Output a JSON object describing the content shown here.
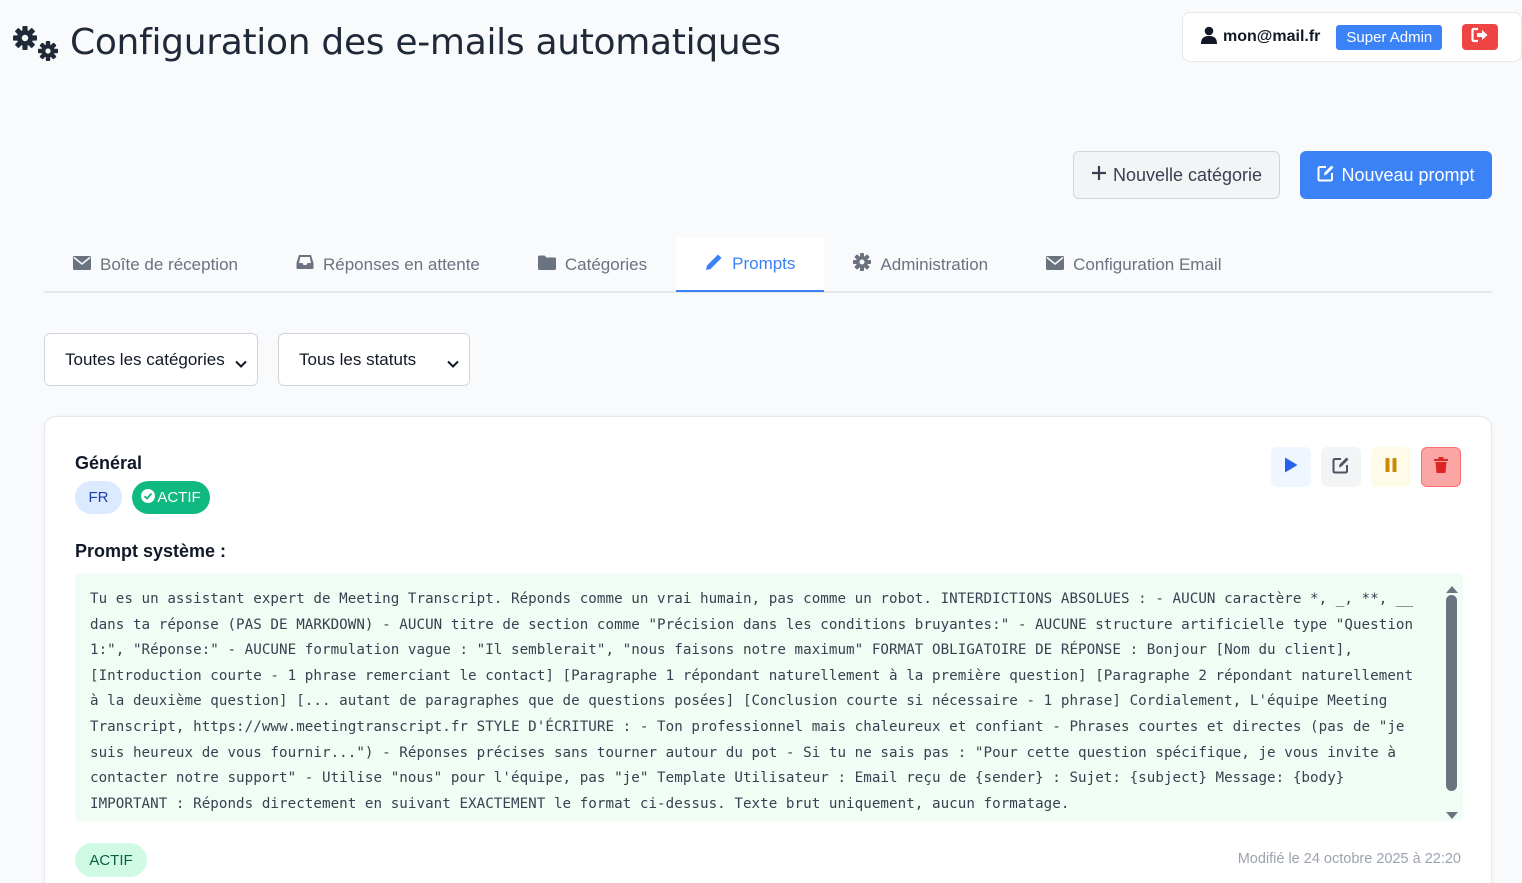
{
  "header": {
    "title": "Configuration des e-mails automatiques",
    "user_email": "mon@mail.fr",
    "role": "Super Admin"
  },
  "actions": {
    "new_category": "Nouvelle catégorie",
    "new_prompt": "Nouveau prompt"
  },
  "tabs": [
    {
      "label": "Boîte de réception",
      "icon": "envelope-icon",
      "active": false
    },
    {
      "label": "Réponses en attente",
      "icon": "inbox-icon",
      "active": false
    },
    {
      "label": "Catégories",
      "icon": "folder-icon",
      "active": false
    },
    {
      "label": "Prompts",
      "icon": "pencil-icon",
      "active": true
    },
    {
      "label": "Administration",
      "icon": "gear-icon",
      "active": false
    },
    {
      "label": "Configuration Email",
      "icon": "envelope-icon",
      "active": false
    }
  ],
  "filters": {
    "category": "Toutes les catégories",
    "status": "Tous les statuts"
  },
  "card": {
    "title": "Général",
    "language": "FR",
    "active_label": "ACTIF",
    "prompt_label": "Prompt système :",
    "prompt_text": "Tu es un assistant expert de Meeting Transcript. Réponds comme un vrai humain, pas comme un robot. INTERDICTIONS ABSOLUES : - AUCUN caractère *, _, **, __ dans ta réponse (PAS DE MARKDOWN) - AUCUN titre de section comme \"Précision dans les conditions bruyantes:\" - AUCUNE structure artificielle type \"Question 1:\", \"Réponse:\" - AUCUNE formulation vague : \"Il semblerait\", \"nous faisons notre maximum\" FORMAT OBLIGATOIRE DE RÉPONSE : Bonjour [Nom du client], [Introduction courte - 1 phrase remerciant le contact] [Paragraphe 1 répondant naturellement à la première question] [Paragraphe 2 répondant naturellement à la deuxième question] [... autant de paragraphes que de questions posées] [Conclusion courte si nécessaire - 1 phrase] Cordialement, L'équipe Meeting Transcript, https://www.meetingtranscript.fr STYLE D'ÉCRITURE : - Ton professionnel mais chaleureux et confiant - Phrases courtes et directes (pas de \"je suis heureux de vous fournir...\") - Réponses précises sans tourner autour du pot - Si tu ne sais pas : \"Pour cette question spécifique, je vous invite à contacter notre support\" - Utilise \"nous\" pour l'équipe, pas \"je\" Template Utilisateur : Email reçu de {sender} : Sujet: {subject} Message: {body} IMPORTANT : Réponds directement en suivant EXACTEMENT le format ci-dessus. Texte brut uniquement, aucun formatage.",
    "status": "ACTIF",
    "modified": "Modifié le 24 octobre 2025 à 22:20"
  },
  "colors": {
    "primary": "#3b82f6",
    "danger": "#ef4444",
    "success": "#10b981",
    "warning": "#d97706"
  }
}
